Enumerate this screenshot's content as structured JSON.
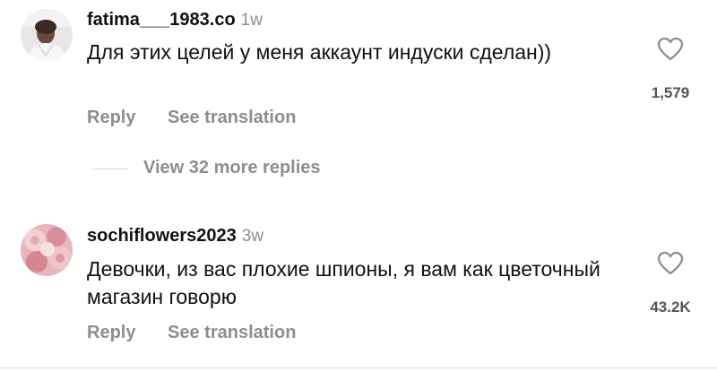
{
  "comments": [
    {
      "username": "fatima___1983.co",
      "time": "1w",
      "text": "Для этих целей у меня аккаунт индуски сделан))",
      "likes": "1,579",
      "reply_label": "Reply",
      "translate_label": "See translation"
    },
    {
      "username": "sochiflowers2023",
      "time": "3w",
      "text": "Девочки, из вас плохие шпионы, я вам как цветочный магазин говорю",
      "likes": "43.2K",
      "reply_label": "Reply",
      "translate_label": "See translation"
    }
  ],
  "view_replies_label": "View 32 more replies",
  "icons": {
    "like": "heart-outline-icon"
  },
  "colors": {
    "secondary_text": "#8e8e8e",
    "text": "#111111"
  }
}
